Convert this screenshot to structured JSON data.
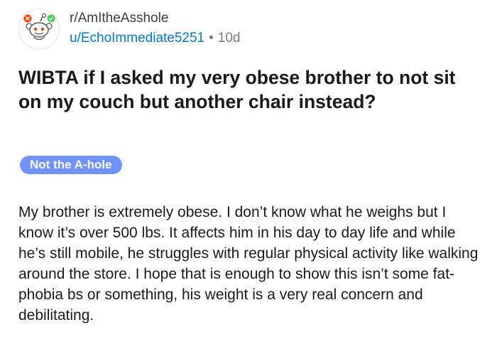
{
  "post": {
    "subreddit": "r/AmItheAsshole",
    "author": "u/EchoImmediate5251",
    "separator": "•",
    "age": "10d",
    "avatar_icon": "snoo-avatar-icon",
    "title": "WIBTA if I asked my very obese brother to not sit on my couch but another chair instead?",
    "flair": {
      "label": "Not the A-hole",
      "color": "#7193ff"
    },
    "body": "My brother is extremely obese. I don’t know what he weighs but I know it’s over 500 lbs. It affects him in his day to day life and while he’s still mobile, he struggles with regular physical activity like walking around the store. I hope that is enough to show this isn’t some fat-phobia bs or something, his weight is a very real concern and debilitating."
  },
  "colors": {
    "username": "#0079d3",
    "muted": "#7c7c7c",
    "text": "#1a1a1b"
  }
}
